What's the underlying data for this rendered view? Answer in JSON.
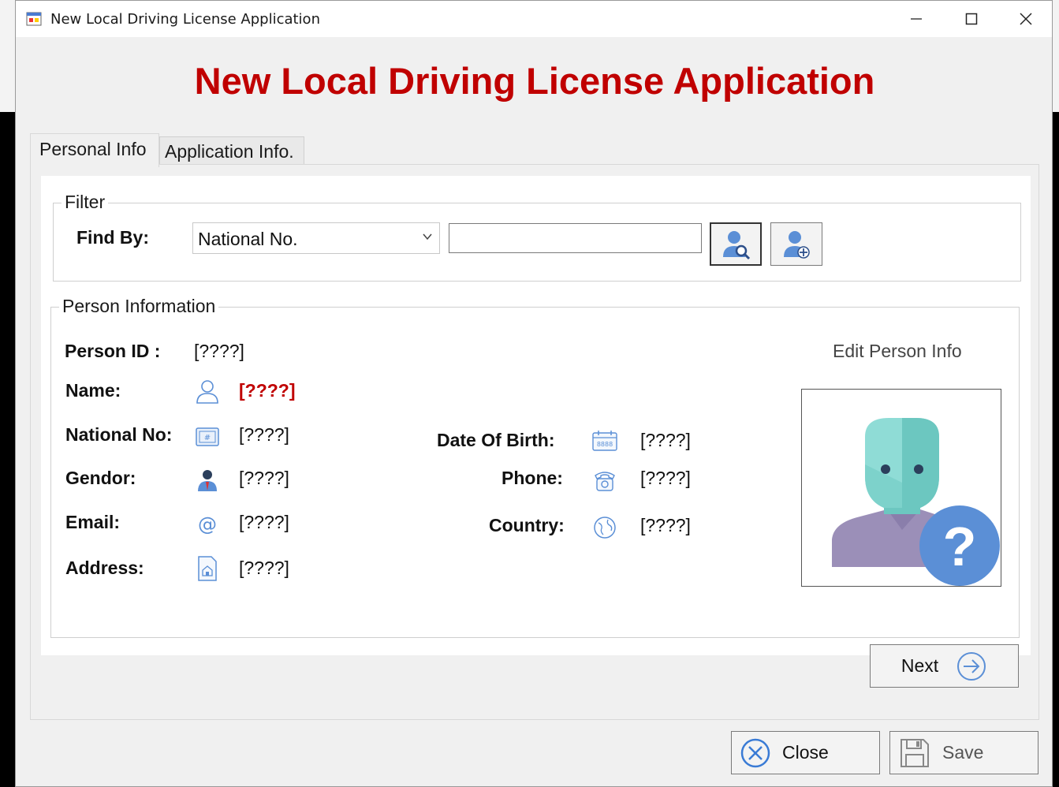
{
  "window": {
    "title": "New Local Driving License Application",
    "controls": {
      "minimize": "—",
      "maximize": "☐",
      "close": "✕"
    }
  },
  "heading": "New Local Driving License Application",
  "tabs": [
    {
      "label": "Personal Info",
      "active": true
    },
    {
      "label": "Application Info.",
      "active": false
    }
  ],
  "filter": {
    "group_label": "Filter",
    "find_by_label": "Find By:",
    "find_by_selected": "National No.",
    "search_value": "",
    "find_button_icon": "search-person-icon",
    "add_button_icon": "add-person-icon"
  },
  "person": {
    "group_label": "Person Information",
    "edit_link": "Edit Person Info",
    "fields": {
      "person_id": {
        "label": "Person ID :",
        "value": "[????]"
      },
      "name": {
        "label": "Name:",
        "value": "[????]",
        "icon": "person-outline-icon"
      },
      "national_no": {
        "label": "National No:",
        "value": "[????]",
        "icon": "id-card-icon"
      },
      "gendor": {
        "label": "Gendor:",
        "value": "[????]",
        "icon": "man-icon"
      },
      "email": {
        "label": "Email:",
        "value": "[????]",
        "icon": "at-sign-icon"
      },
      "address": {
        "label": "Address:",
        "value": "[????]",
        "icon": "house-document-icon"
      },
      "date_of_birth": {
        "label": "Date Of Birth:",
        "value": "[????]",
        "icon": "calendar-icon"
      },
      "phone": {
        "label": "Phone:",
        "value": "[????]",
        "icon": "telephone-icon"
      },
      "country": {
        "label": "Country:",
        "value": "[????]",
        "icon": "globe-icon"
      }
    },
    "photo_icon": "unknown-person-icon"
  },
  "buttons": {
    "next": "Next",
    "close": "Close",
    "save": "Save"
  },
  "colors": {
    "heading": "#c00000",
    "name_value": "#c00000",
    "icon_blue": "#5b8fd6"
  }
}
